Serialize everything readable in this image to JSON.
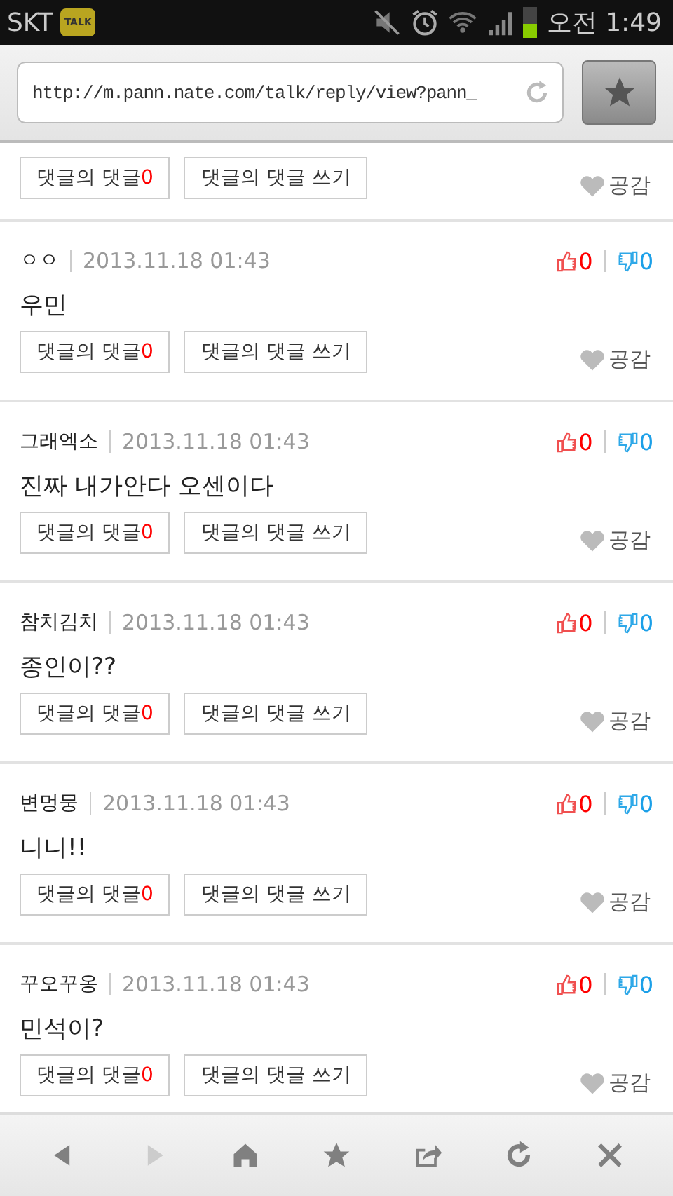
{
  "status_bar": {
    "carrier": "SKT",
    "app_badge": "TALK",
    "time": "오전 1:49"
  },
  "address_bar": {
    "url": "http://m.pann.nate.com/talk/reply/view?pann_"
  },
  "partial_comment": {
    "reply_label": "댓글의 댓글",
    "reply_count": "0",
    "write_label": "댓글의 댓글 쓰기",
    "empathy_label": "공감"
  },
  "comments": [
    {
      "author": "ㅇㅇ",
      "date": "2013.11.18 01:43",
      "likes": "0",
      "dislikes": "0",
      "text": "우민",
      "reply_label": "댓글의 댓글",
      "reply_count": "0",
      "write_label": "댓글의 댓글 쓰기",
      "empathy_label": "공감"
    },
    {
      "author": "그래엑소",
      "date": "2013.11.18 01:43",
      "likes": "0",
      "dislikes": "0",
      "text": "진짜 내가안다 오센이다",
      "reply_label": "댓글의 댓글",
      "reply_count": "0",
      "write_label": "댓글의 댓글 쓰기",
      "empathy_label": "공감"
    },
    {
      "author": "참치김치",
      "date": "2013.11.18 01:43",
      "likes": "0",
      "dislikes": "0",
      "text": "종인이??",
      "reply_label": "댓글의 댓글",
      "reply_count": "0",
      "write_label": "댓글의 댓글 쓰기",
      "empathy_label": "공감"
    },
    {
      "author": "변멍뭉",
      "date": "2013.11.18 01:43",
      "likes": "0",
      "dislikes": "0",
      "text": "니니!!",
      "reply_label": "댓글의 댓글",
      "reply_count": "0",
      "write_label": "댓글의 댓글 쓰기",
      "empathy_label": "공감"
    },
    {
      "author": "꾸오꾸옹",
      "date": "2013.11.18 01:43",
      "likes": "0",
      "dislikes": "0",
      "text": "민석이?",
      "reply_label": "댓글의 댓글",
      "reply_count": "0",
      "write_label": "댓글의 댓글 쓰기",
      "empathy_label": "공감"
    }
  ],
  "toolbar": [
    {
      "kind": "back",
      "disabled": false
    },
    {
      "kind": "forward",
      "disabled": true
    },
    {
      "kind": "home",
      "disabled": false
    },
    {
      "kind": "bookmark",
      "disabled": false
    },
    {
      "kind": "share",
      "disabled": false
    },
    {
      "kind": "refresh",
      "disabled": false
    },
    {
      "kind": "close",
      "disabled": false
    }
  ]
}
